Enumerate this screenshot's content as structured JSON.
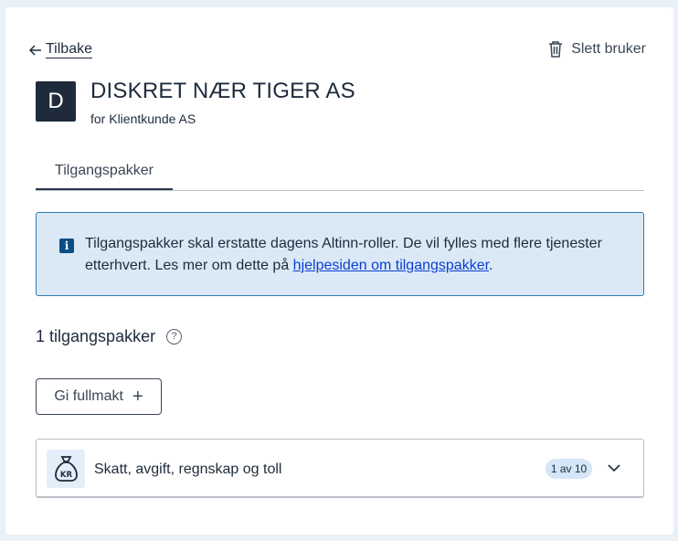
{
  "header": {
    "back_label": "Tilbake",
    "delete_label": "Slett bruker"
  },
  "user": {
    "initial": "D",
    "name": "DISKRET NÆR TIGER AS",
    "subtitle": "for Klientkunde AS"
  },
  "tabs": [
    {
      "label": "Tilgangspakker",
      "active": true
    }
  ],
  "alert": {
    "text": "Tilgangspakker skal erstatte dagens Altinn-roller. De vil fylles med flere tjenester etterhvert. Les mer om dette på ",
    "link_text": "hjelpesiden om tilgangspakker",
    "suffix": "."
  },
  "packages": {
    "count_label": "1 tilgangspakker",
    "help_icon_glyph": "?",
    "add_button_label": "Gi fullmakt",
    "items": [
      {
        "name": "Skatt, avgift, regnskap og toll",
        "badge": "1 av 10",
        "icon": "money-bag-kr-icon"
      }
    ]
  },
  "colors": {
    "accent": "#0b4d86",
    "alert_bg": "#dbe9f6",
    "alert_border": "#2e7bb0",
    "avatar_bg": "#1f2b3a"
  }
}
